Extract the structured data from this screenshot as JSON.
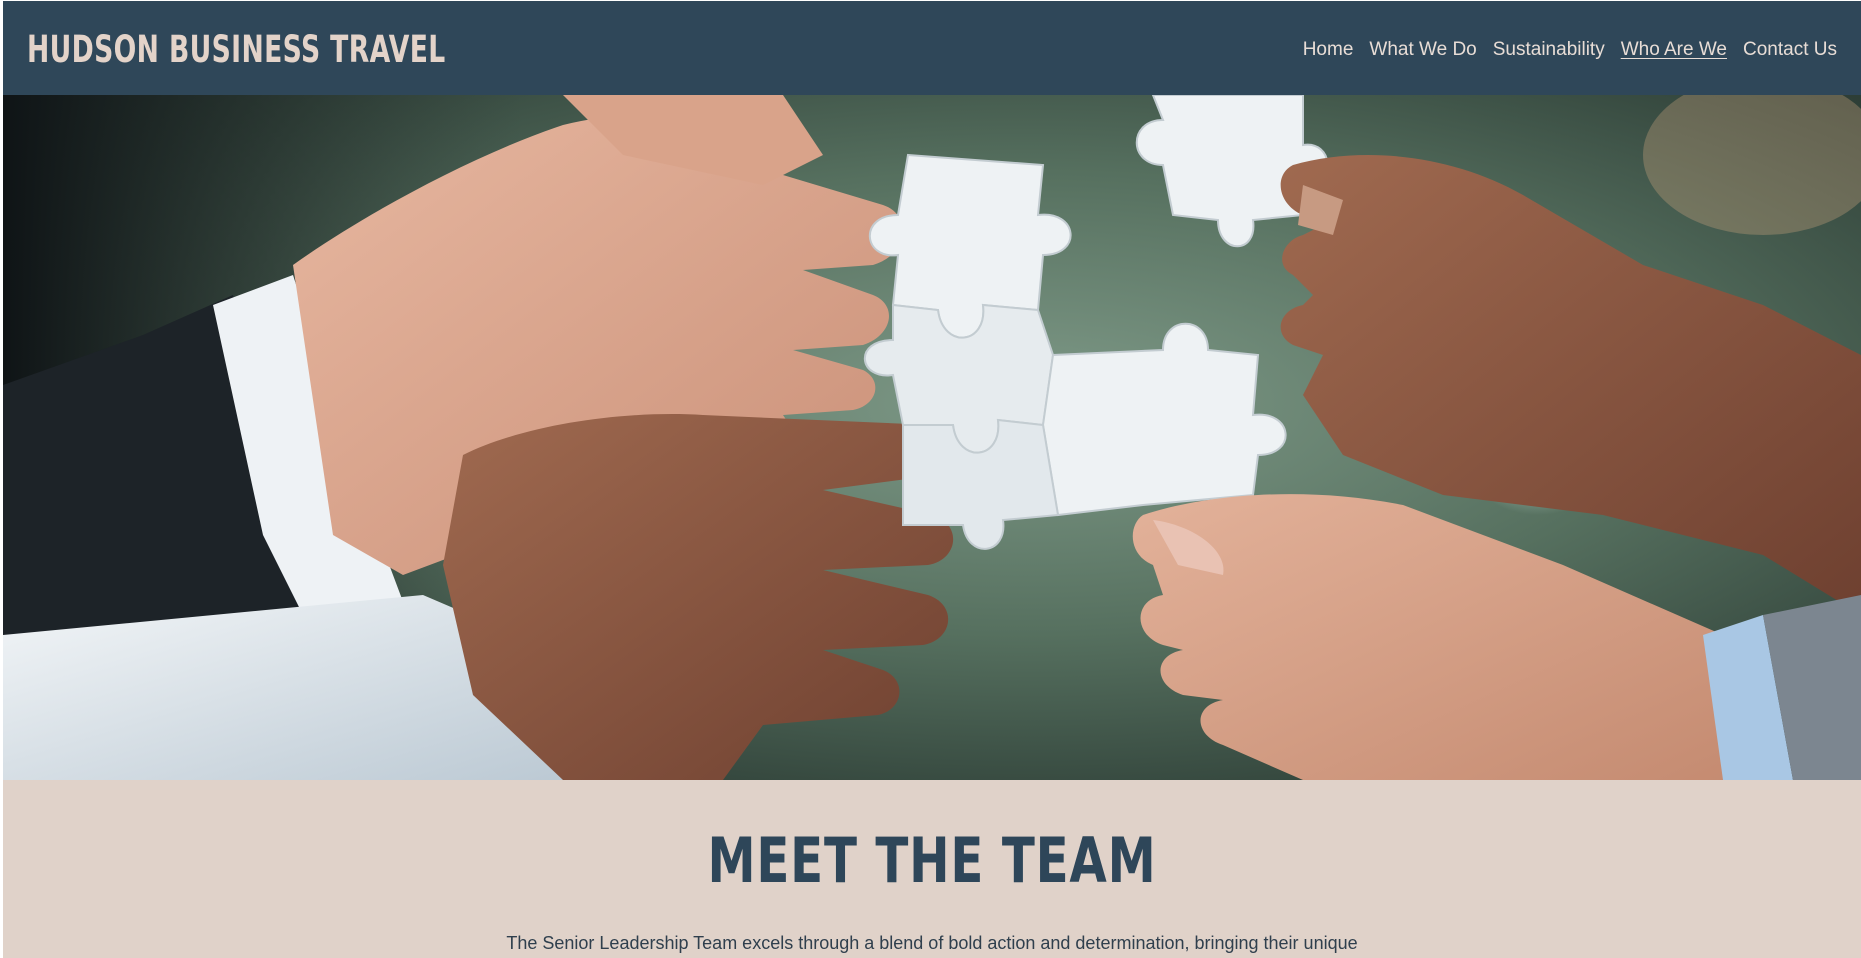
{
  "header": {
    "brand": "HUDSON BUSINESS TRAVEL",
    "nav": [
      {
        "label": "Home"
      },
      {
        "label": "What We Do"
      },
      {
        "label": "Sustainability"
      },
      {
        "label": "Who Are We",
        "active": true
      },
      {
        "label": "Contact Us"
      }
    ]
  },
  "hero": {
    "image": "hands-holding-puzzle-pieces"
  },
  "team": {
    "title": "MEET THE TEAM",
    "intro": "The Senior Leadership Team excels through a blend of bold action and determination, bringing their unique"
  },
  "colors": {
    "header_bg": "#2f4759",
    "brand_text": "#e3d3c9",
    "section_bg": "#e0d2c9",
    "title_text": "#2e4659"
  }
}
